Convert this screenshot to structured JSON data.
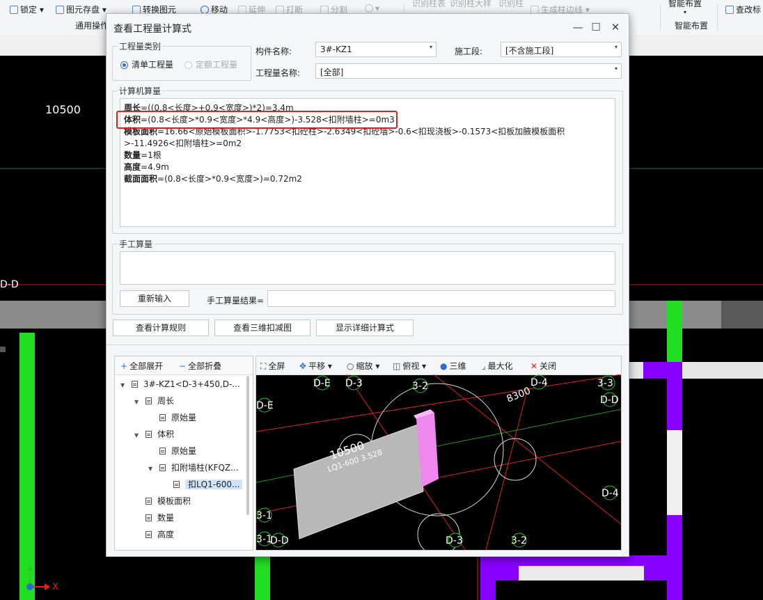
{
  "ribbon": {
    "lock": "锁定",
    "element_save": "图元存盘",
    "convert_element": "转换图元",
    "move": "移动",
    "extend": "延伸",
    "break": "打断",
    "split": "分割",
    "group_common": "通用操作",
    "identify_table": "识别柱表",
    "identify_col_detail": "识别柱大样",
    "identify_col": "识别柱",
    "generate_col_edge": "生成柱边线",
    "smart_layout": "智能布置",
    "smart_layout_group": "智能布置",
    "change_mark": "查改标"
  },
  "canvas": {
    "label_10500": "10500",
    "axis_dd": "D-D",
    "axis_x": "X"
  },
  "dialog": {
    "title": "查看工程量计算式",
    "qty_type_group": "工程量类别",
    "radio_list": "清单工程量",
    "radio_quota": "定额工程量",
    "comp_name_label": "构件名称:",
    "comp_name_value": "3#-KZ1",
    "stage_label": "施工段:",
    "stage_value": "[不含施工段]",
    "qty_name_label": "工程量名称:",
    "qty_name_value": "[全部]",
    "computer_calc_group": "计算机算量",
    "calc_lines": [
      {
        "key": "周长",
        "expr": "=((0.8<长度>+0.9<宽度>)*2)=3.4m"
      },
      {
        "key": "体积",
        "expr": "=(0.8<长度>*0.9<宽度>*4.9<高度>)-3.528<扣附墙柱>=0m3"
      },
      {
        "key": "模板面积",
        "expr": "=16.66<原始模板面积>-1.7753<扣砼柱>-2.6349<扣砼墙>-0.6<扣现浇板>-0.1573<扣板加腋模板面积>-11.4926<扣附墙柱>=0m2"
      },
      {
        "key": "数量",
        "expr": "=1根"
      },
      {
        "key": "高度",
        "expr": "=4.9m"
      },
      {
        "key": "截面面积",
        "expr": "=(0.8<长度>*0.9<宽度>)=0.72m2"
      }
    ],
    "manual_calc_group": "手工算量",
    "reenter_button": "重新输入",
    "manual_result_label": "手工算量结果=",
    "manual_result_value": "",
    "view_rules_button": "查看计算规则",
    "view_3d_button": "查看三维扣减图",
    "show_detail_button": "显示详细计算式"
  },
  "tree": {
    "expand_all": "全部展开",
    "collapse_all": "全部折叠",
    "nodes": [
      {
        "label": "3#-KZ1<D-3+450,D-...",
        "expanded": true
      },
      {
        "label": "周长",
        "expanded": true
      },
      {
        "label": "原始量"
      },
      {
        "label": "体积",
        "expanded": true
      },
      {
        "label": "原始量"
      },
      {
        "label": "扣附墙柱(KFQZ...",
        "expanded": true
      },
      {
        "label": "扣LQ1-600...",
        "selected": true
      },
      {
        "label": "模板面积"
      },
      {
        "label": "数量"
      },
      {
        "label": "高度"
      }
    ]
  },
  "viewer": {
    "fullscreen": "全屏",
    "pan": "平移",
    "zoom": "缩放",
    "topview": "俯视",
    "threed": "三维",
    "maximize": "最大化",
    "close": "关闭",
    "labels": {
      "de1": "D-E",
      "d3a": "D-3",
      "t32a": "3-2",
      "d4": "D-4",
      "dim8300": "8300",
      "t33": "3-3",
      "dd": "D-D",
      "de2": "D-E",
      "d4b": "D-4",
      "dim10500": "10500",
      "lq": "LQ1-600 3.528",
      "t31a": "3-1",
      "t31b": "3-1",
      "dd2": "D-D",
      "d3b": "D-3",
      "t32b": "3-2"
    }
  },
  "colors": {
    "highlight": "#e02020",
    "accent": "#2e6bd6",
    "green": "#22dd22",
    "purple": "#8800ff"
  }
}
